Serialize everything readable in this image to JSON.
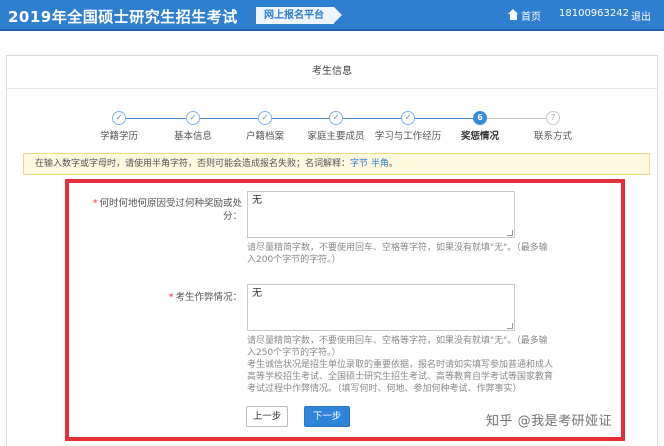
{
  "header": {
    "title": "2019年全国硕士研究生招生考试",
    "platform_badge": "网上报名平台",
    "home_label": "首页",
    "phone": "18100963242",
    "logout_label": "退出"
  },
  "panel": {
    "title": "考生信息"
  },
  "steps": [
    {
      "num": "✓",
      "label": "学籍学历",
      "state": "done"
    },
    {
      "num": "✓",
      "label": "基本信息",
      "state": "done"
    },
    {
      "num": "✓",
      "label": "户籍档案",
      "state": "done"
    },
    {
      "num": "✓",
      "label": "家庭主要成员",
      "state": "done"
    },
    {
      "num": "✓",
      "label": "学习与工作经历",
      "state": "done"
    },
    {
      "num": "6",
      "label": "奖惩情况",
      "state": "active"
    },
    {
      "num": "7",
      "label": "联系方式",
      "state": "future"
    }
  ],
  "notice": {
    "text": "在输入数字或字母时，请使用半角字符，否则可能会造成报名失败；名词解释：",
    "term1": "字节",
    "term2": "半角",
    "end": "。"
  },
  "form": {
    "awards": {
      "required_mark": "*",
      "label_line1": "何时何地何原因受过何种奖励或处",
      "label_line2": "分：",
      "value": "无",
      "hint_line1": "请尽量精简字数，不要使用回车、空格等字符，如果没有就填\"无\"。（最多输",
      "hint_line2": "入200个字节的字符。）"
    },
    "cheating": {
      "required_mark": "*",
      "label": "考生作弊情况：",
      "value": "无",
      "hint_line1": "请尽量精简字数，不要使用回车、空格等字符，如果没有就填\"无\"。（最多输",
      "hint_line2": "入250个字节的字符。）",
      "hint_line3": "考生诚信状况是招生单位录取的重要依据，报名时请如实填写参加普通和成人",
      "hint_line4": "高等学校招生考试、全国硕士研究生招生考试、高等教育自学考试等国家教育",
      "hint_line5": "考试过程中作弊情况。（填写何时、何地、参加何种考试、作弊事实）"
    }
  },
  "buttons": {
    "prev": "上一步",
    "next": "下一步"
  },
  "watermark": "知乎 @我是考研娅证",
  "colors": {
    "header_blue": "#2f7fd0",
    "highlight_red": "#e5303a",
    "button_blue": "#2e84d8"
  }
}
